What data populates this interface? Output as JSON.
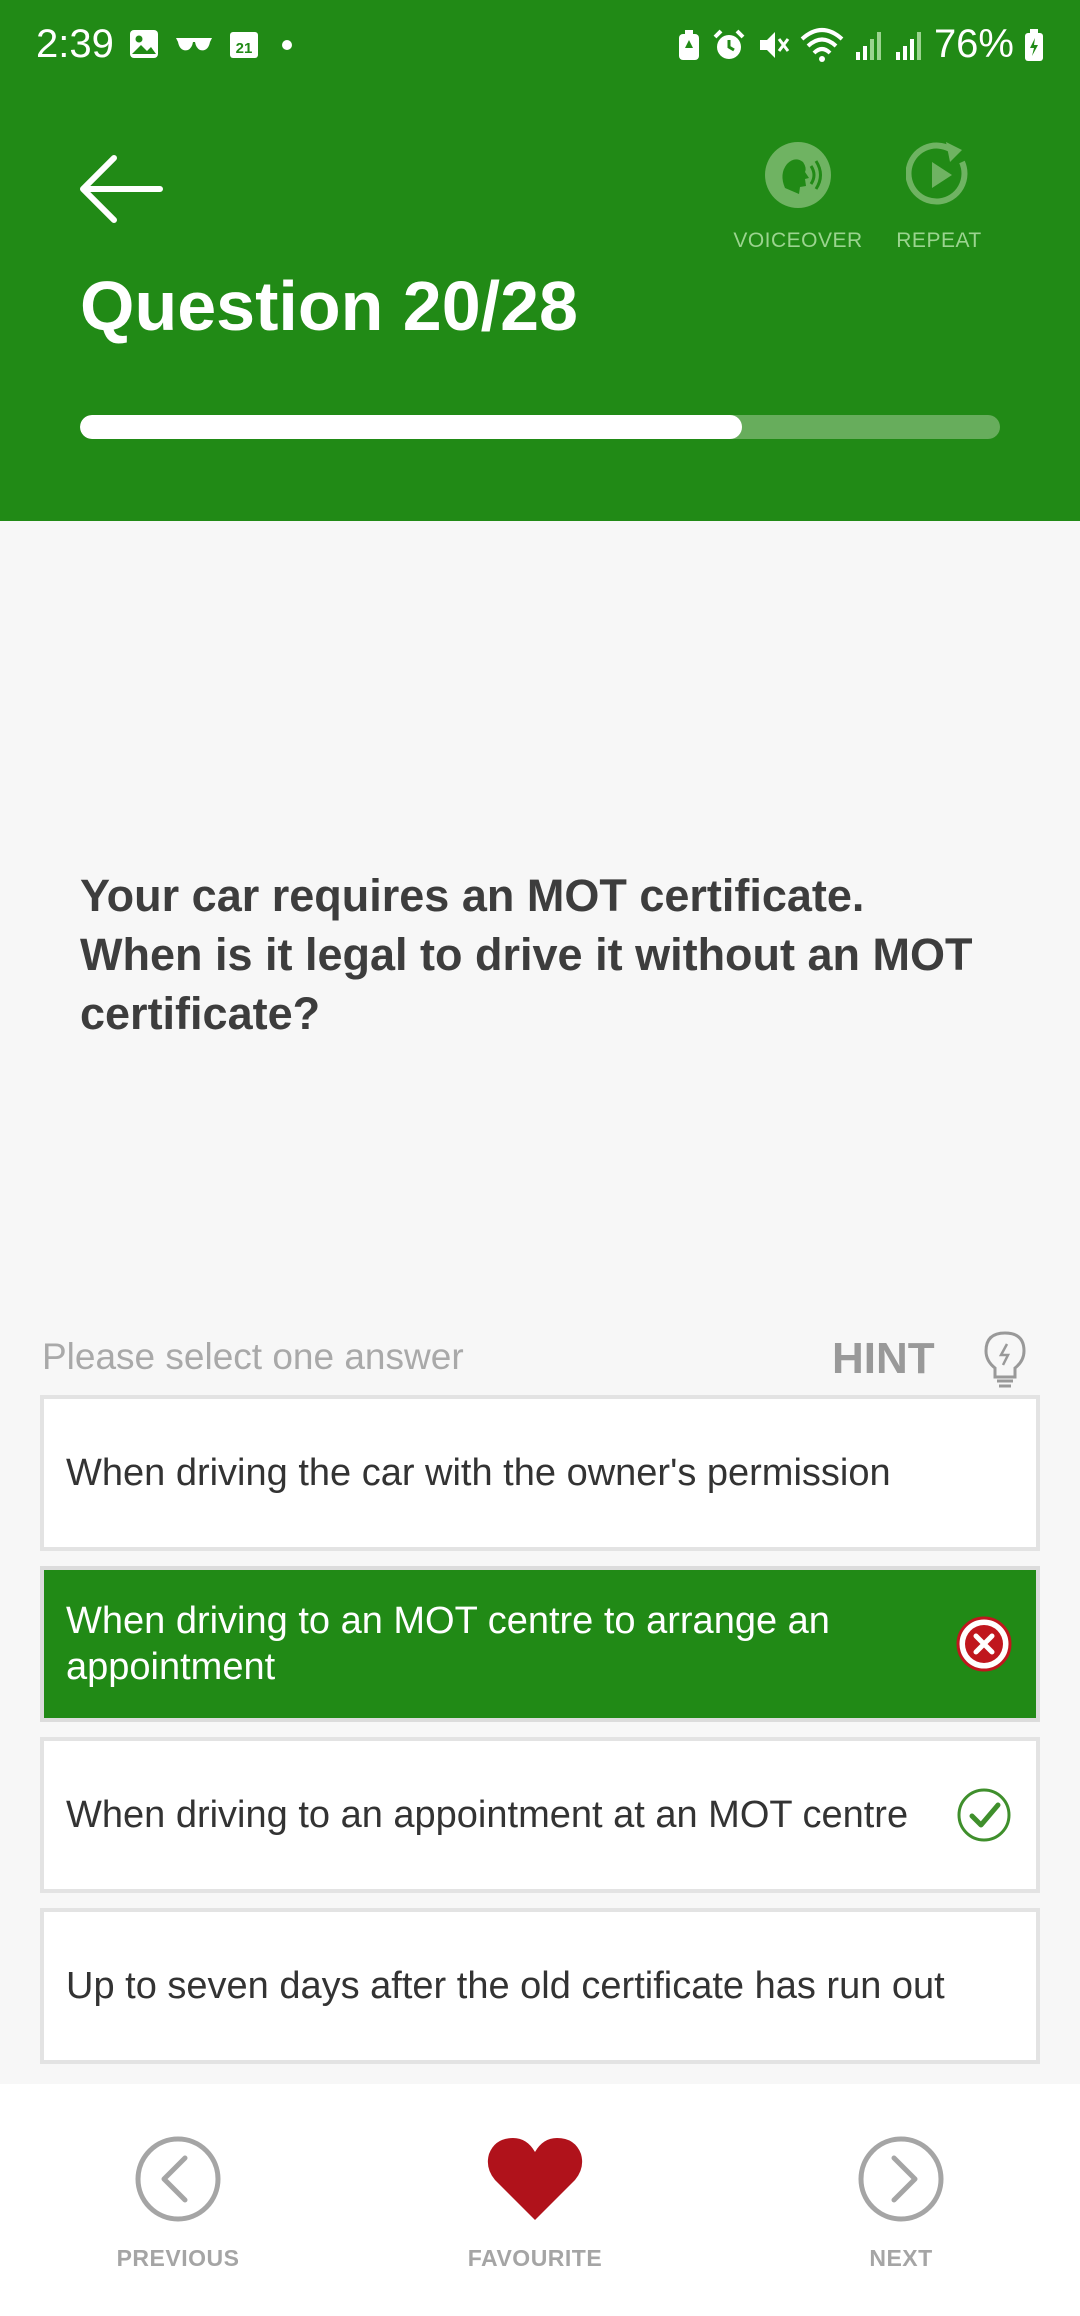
{
  "status_bar": {
    "time": "2:39",
    "battery": "76%",
    "left_icons": [
      "gallery-icon",
      "glasses-icon",
      "calendar-icon",
      "dot-icon"
    ],
    "right_icons": [
      "battery-saver-icon",
      "alarm-icon",
      "mute-icon",
      "wifi-icon",
      "signal-icon",
      "signal-icon",
      "battery-icon"
    ],
    "calendar_day": "21"
  },
  "header": {
    "title": "Question 20/28",
    "voiceover_label": "VOICEOVER",
    "repeat_label": "REPEAT",
    "progress": 0.72
  },
  "question": {
    "text": "Your car requires an MOT certificate. When is it legal to drive it without an MOT certificate?"
  },
  "answers_section": {
    "prompt": "Please select one answer",
    "hint_label": "HINT"
  },
  "answers": [
    {
      "text": "When driving the car with the owner's permission",
      "selected": false,
      "mark": ""
    },
    {
      "text": "When driving to an MOT centre to arrange an appointment",
      "selected": true,
      "mark": "wrong"
    },
    {
      "text": "When driving to an appointment at an MOT centre",
      "selected": false,
      "mark": "correct"
    },
    {
      "text": "Up to seven days after the old certificate has run out",
      "selected": false,
      "mark": ""
    }
  ],
  "bottom_nav": {
    "previous_label": "PREVIOUS",
    "favourite_label": "FAVOURITE",
    "next_label": "NEXT"
  },
  "colors": {
    "brand_green": "#218a16",
    "favourite_red": "#b0121b",
    "wrong_red": "#c0161d",
    "correct_green": "#3f8f2c"
  }
}
